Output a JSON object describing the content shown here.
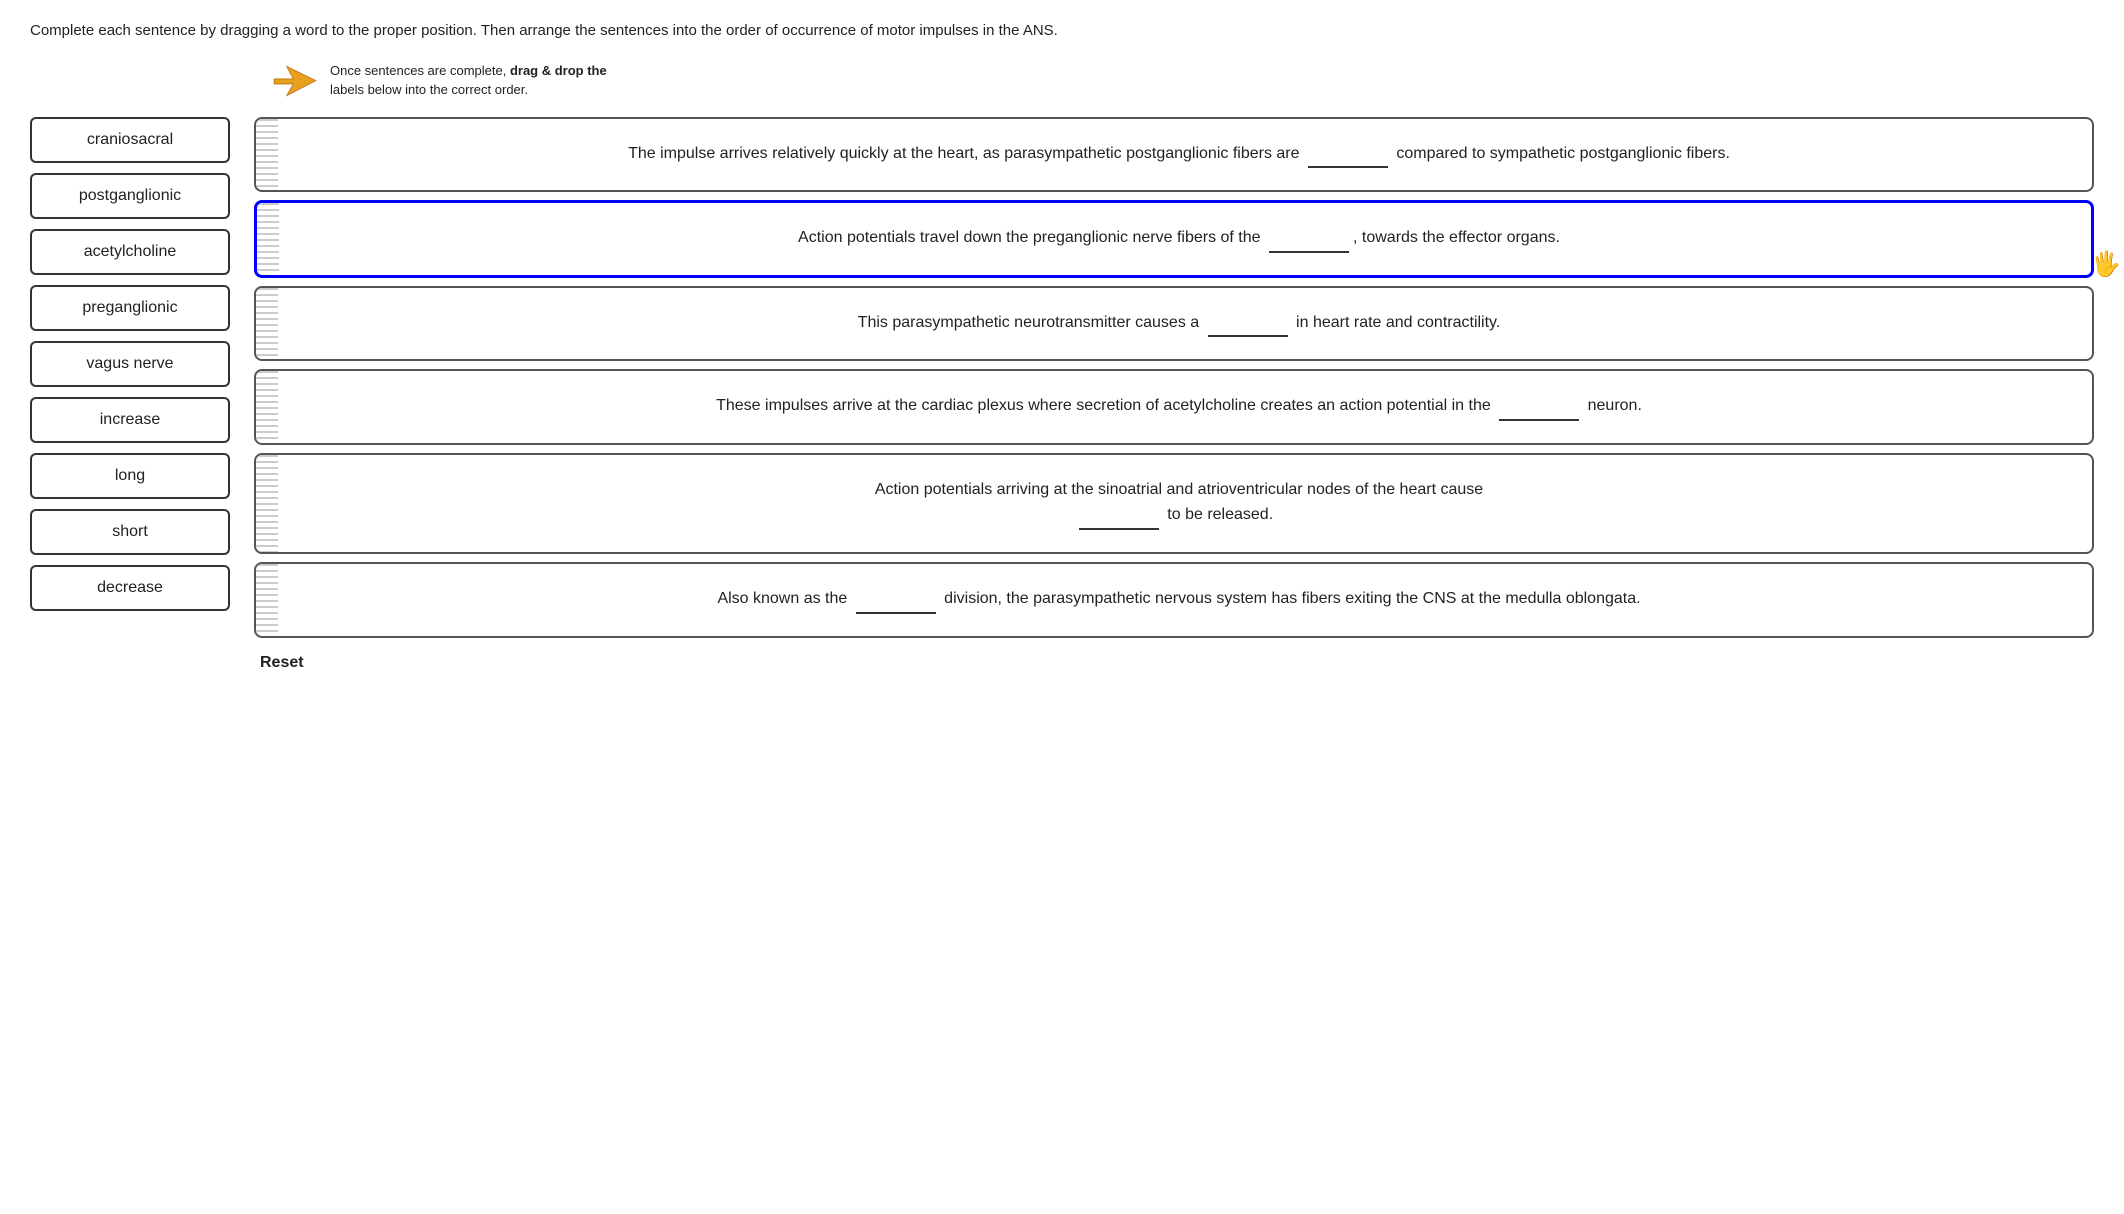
{
  "instruction": "Complete each sentence by dragging a word to the proper position. Then arrange the sentences into the order of occurrence of motor impulses in the ANS.",
  "drag_hint": {
    "line1": "Once sentences are complete,",
    "line2_bold": "drag & drop the",
    "line3": "labels below into the correct order."
  },
  "word_bank": [
    {
      "id": "w1",
      "label": "craniosacral"
    },
    {
      "id": "w2",
      "label": "postganglionic"
    },
    {
      "id": "w3",
      "label": "acetylcholine"
    },
    {
      "id": "w4",
      "label": "preganglionic"
    },
    {
      "id": "w5",
      "label": "vagus nerve"
    },
    {
      "id": "w6",
      "label": "increase"
    },
    {
      "id": "w7",
      "label": "long"
    },
    {
      "id": "w8",
      "label": "short"
    },
    {
      "id": "w9",
      "label": "decrease"
    }
  ],
  "sentences": [
    {
      "id": "s1",
      "text_before": "The impulse arrives relatively quickly at the heart, as parasympathetic postganglionic fibers are",
      "blank": "________",
      "text_after": "compared to sympathetic postganglionic fibers.",
      "highlighted": false
    },
    {
      "id": "s2",
      "text_before": "Action potentials travel down the preganglionic nerve fibers of the",
      "blank": "________",
      "text_after": ", towards the effector organs.",
      "highlighted": true
    },
    {
      "id": "s3",
      "text_before": "This parasympathetic neurotransmitter causes a",
      "blank": "________",
      "text_after": "in heart rate and contractility.",
      "highlighted": false
    },
    {
      "id": "s4",
      "text_before": "These impulses arrive at the cardiac plexus where secretion of acetylcholine creates an action potential in the",
      "blank": "________",
      "text_after": "neuron.",
      "highlighted": false
    },
    {
      "id": "s5",
      "text_before": "Action potentials arriving at the sinoatrial and atrioventricular nodes of the heart cause",
      "blank": "________",
      "text_after": "to be released.",
      "highlighted": false
    },
    {
      "id": "s6",
      "text_before": "Also known as the",
      "blank": "________",
      "text_after": "division, the parasympathetic nervous system has fibers exiting the CNS at the medulla oblongata.",
      "highlighted": false
    }
  ],
  "reset_label": "Reset"
}
